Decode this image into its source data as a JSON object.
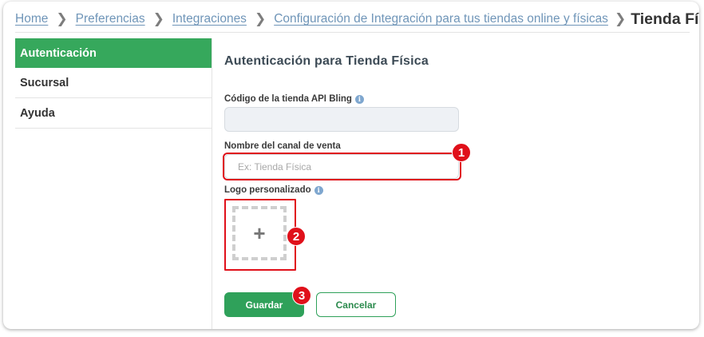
{
  "breadcrumb": {
    "items": [
      "Home",
      "Preferencias",
      "Integraciones",
      "Configuración de Integración para tus tiendas online y físicas"
    ],
    "current": "Tienda Física"
  },
  "sidebar": {
    "items": [
      {
        "label": "Autenticación",
        "active": true
      },
      {
        "label": "Sucursal",
        "active": false
      },
      {
        "label": "Ayuda",
        "active": false
      }
    ]
  },
  "main": {
    "title": "Autenticación para Tienda Física",
    "store_code": {
      "label": "Código de la tienda API Bling",
      "value": "",
      "placeholder": ""
    },
    "channel_name": {
      "label": "Nombre del canal de venta",
      "value": "",
      "placeholder": "Ex: Tienda Física"
    },
    "logo": {
      "label": "Logo personalizado",
      "icon": "plus-icon"
    },
    "buttons": {
      "save": "Guardar",
      "cancel": "Cancelar"
    }
  },
  "annotations": {
    "marker1": "1",
    "marker2": "2",
    "marker3": "3"
  },
  "colors": {
    "accent": "#36a85c",
    "highlight": "#e0101a",
    "link": "#6f95b8"
  }
}
